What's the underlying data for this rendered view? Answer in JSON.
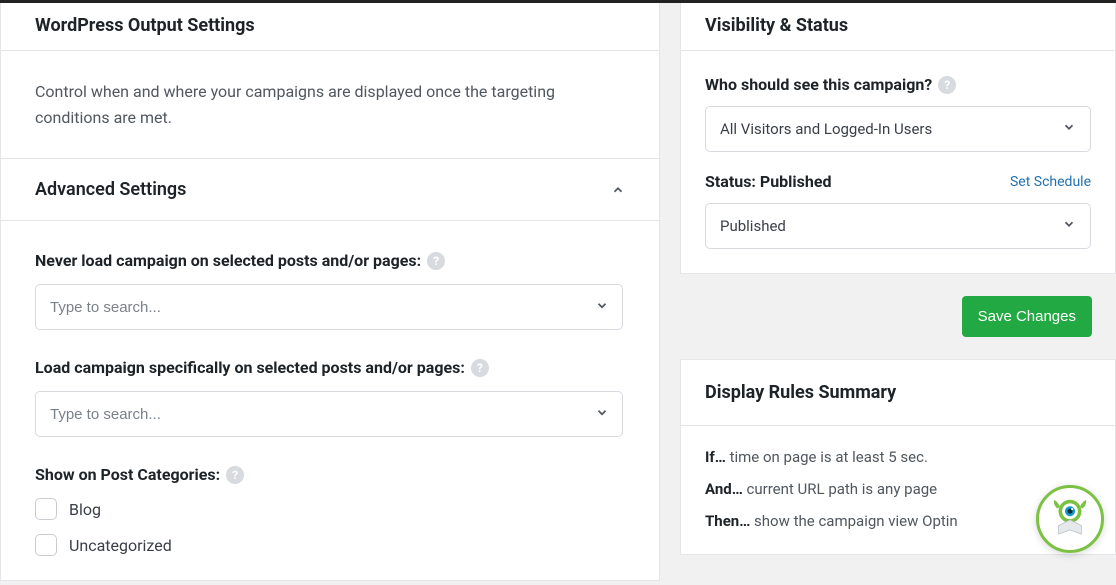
{
  "main": {
    "title": "WordPress Output Settings",
    "intro": "Control when and where your campaigns are displayed once the targeting conditions are met.",
    "advanced": {
      "title": "Advanced Settings",
      "never_load": {
        "label": "Never load campaign on selected posts and/or pages:",
        "placeholder": "Type to search..."
      },
      "load_specific": {
        "label": "Load campaign specifically on selected posts and/or pages:",
        "placeholder": "Type to search..."
      },
      "categories": {
        "label": "Show on Post Categories:",
        "items": [
          "Blog",
          "Uncategorized"
        ]
      }
    }
  },
  "sidebar": {
    "visibility": {
      "title": "Visibility & Status",
      "who_label": "Who should see this campaign?",
      "who_value": "All Visitors and Logged-In Users",
      "status_label": "Status: Published",
      "schedule_link": "Set Schedule",
      "status_value": "Published"
    },
    "save_label": "Save Changes",
    "rules": {
      "title": "Display Rules Summary",
      "r1_prefix": "If…",
      "r1_text": " time on page is at least 5 sec.",
      "r2_prefix": "And…",
      "r2_text": " current URL path is any page",
      "r3_prefix": "Then…",
      "r3_text": " show the campaign view Optin"
    }
  },
  "help_glyph": "?"
}
